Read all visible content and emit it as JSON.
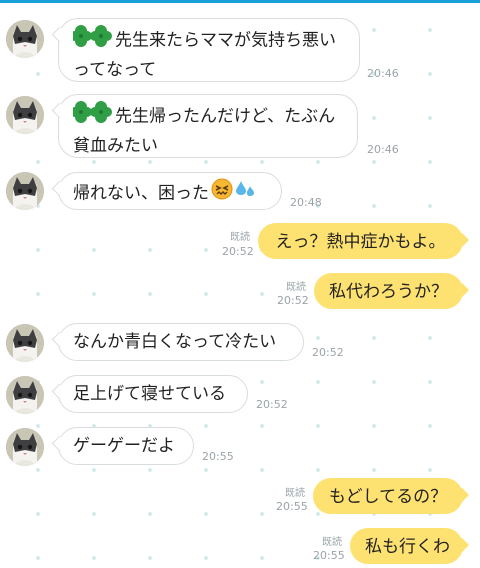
{
  "colors": {
    "accent": "#1aa0d8",
    "outgoing_bubble": "#fee271",
    "incoming_bubble": "#ffffff",
    "time_text": "#9aa4a8"
  },
  "messages": [
    {
      "direction": "in",
      "icon": "four-leaf-clover-icon",
      "line1": "先生来たらママが気持ち悪い",
      "line2": "ってなって",
      "time": "20:46"
    },
    {
      "direction": "in",
      "icon": "four-leaf-clover-icon",
      "line1": "先生帰ったんだけど、たぶん",
      "line2": "貧血みたい",
      "time": "20:46"
    },
    {
      "direction": "in",
      "text": "帰れない、困った",
      "emojis": [
        "confounded-face-icon",
        "sweat-droplets-icon"
      ],
      "time": "20:48"
    },
    {
      "direction": "out",
      "text": "えっ？熱中症かもよ。",
      "read": "既読",
      "time": "20:52"
    },
    {
      "direction": "out",
      "text": "私代わろうか？",
      "read": "既読",
      "time": "20:52"
    },
    {
      "direction": "in",
      "text": "なんか青白くなって冷たい",
      "time": "20:52"
    },
    {
      "direction": "in",
      "text": "足上げて寝せている",
      "time": "20:52"
    },
    {
      "direction": "in",
      "text": "ゲーゲーだよ",
      "time": "20:55"
    },
    {
      "direction": "out",
      "text": "もどしてるの？",
      "read": "既読",
      "time": "20:55"
    },
    {
      "direction": "out",
      "text": "私も行くわ",
      "read": "既読",
      "time": "20:55"
    }
  ]
}
